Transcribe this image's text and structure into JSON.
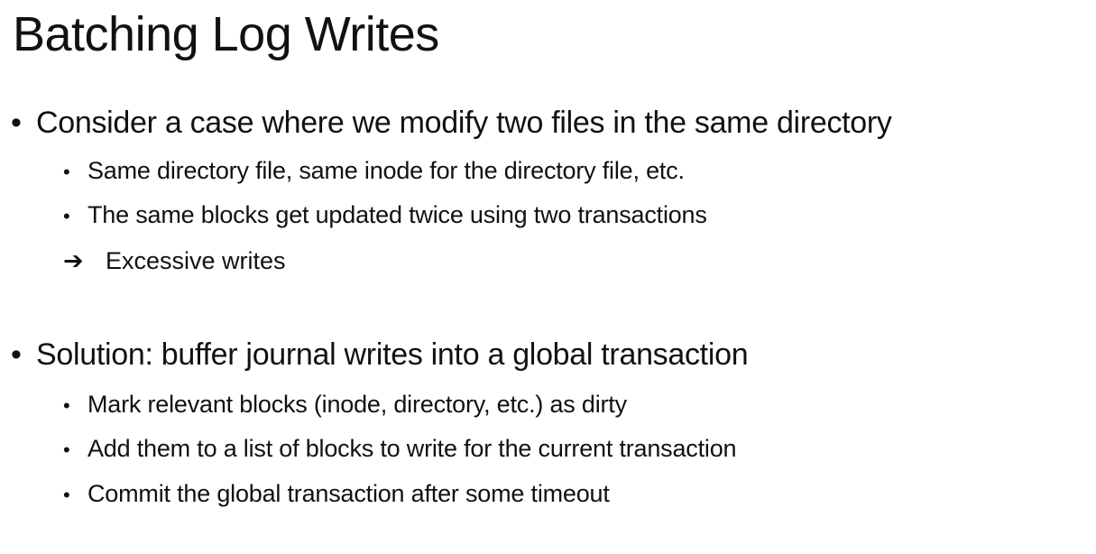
{
  "slide": {
    "title": "Batching Log Writes",
    "sections": [
      {
        "bullet": "•",
        "text": "Consider a case where we modify two files in the same directory",
        "subitems": [
          "Same directory file, same inode for the directory file, etc.",
          "The same blocks get updated twice using two transactions"
        ],
        "arrow_symbol": "➔",
        "arrow_text": "Excessive writes"
      },
      {
        "bullet": "•",
        "text": "Solution: buffer journal writes into a global transaction",
        "subitems": [
          "Mark relevant blocks (inode, directory, etc.) as dirty",
          "Add them to a list of blocks to write for the current transaction",
          "Commit the global transaction after some timeout"
        ]
      }
    ],
    "sub_bullet": "•"
  }
}
